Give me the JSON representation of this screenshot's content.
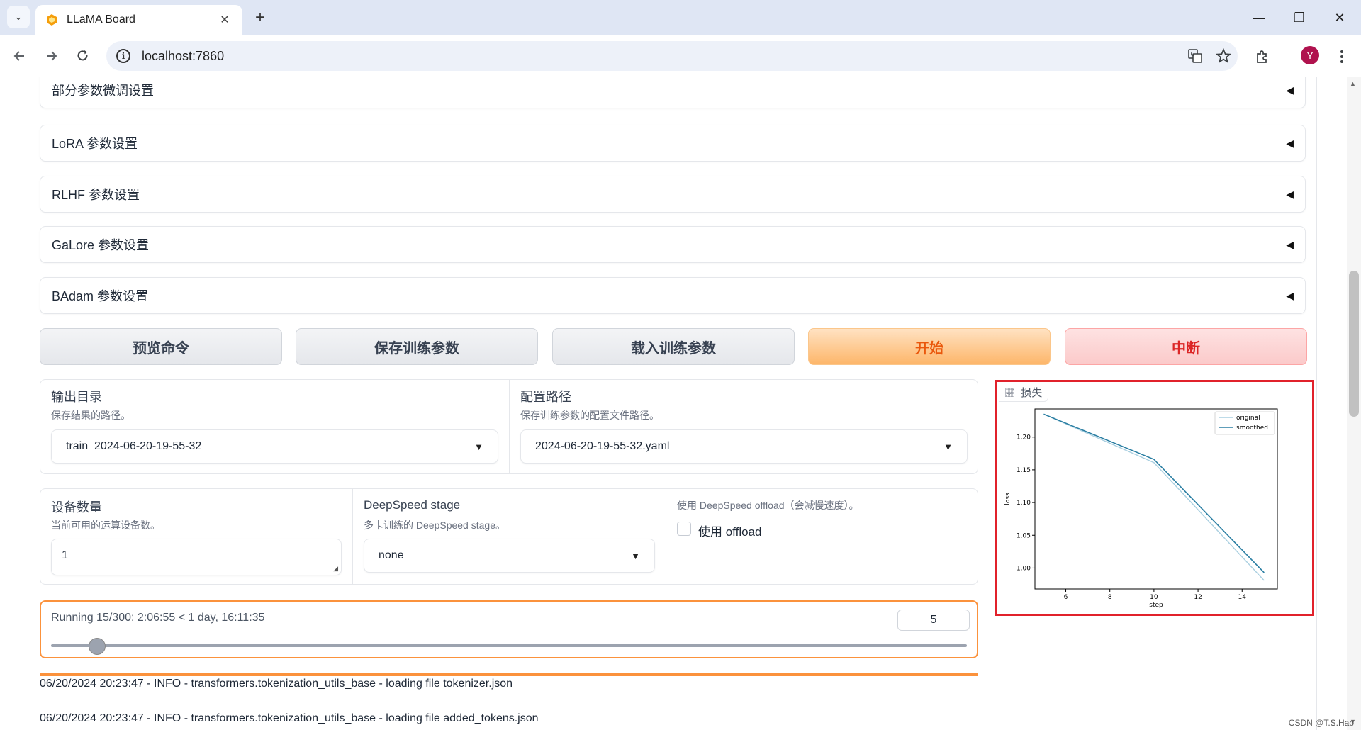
{
  "browser": {
    "tab_title": "LLaMA Board",
    "tab_close": "✕",
    "new_tab": "+",
    "tab_menu": "⌄",
    "url": "localhost:7860",
    "avatar_letter": "Y",
    "info_glyph": "i",
    "minimize": "—",
    "restore": "❐",
    "close": "✕"
  },
  "accordions": [
    {
      "label": "部分参数微调设置"
    },
    {
      "label": "LoRA 参数设置"
    },
    {
      "label": "RLHF 参数设置"
    },
    {
      "label": "GaLore 参数设置"
    },
    {
      "label": "BAdam 参数设置"
    }
  ],
  "accordion_caret": "◀",
  "actions": {
    "preview": "预览命令",
    "save": "保存训练参数",
    "load": "载入训练参数",
    "start": "开始",
    "stop": "中断"
  },
  "output_dir": {
    "title": "输出目录",
    "info": "保存结果的路径。",
    "value": "train_2024-06-20-19-55-32"
  },
  "config_path": {
    "title": "配置路径",
    "info": "保存训练参数的配置文件路径。",
    "value": "2024-06-20-19-55-32.yaml"
  },
  "device_count": {
    "title": "设备数量",
    "info": "当前可用的运算设备数。",
    "value": "1"
  },
  "deepspeed_stage": {
    "title": "DeepSpeed stage",
    "info": "多卡训练的 DeepSpeed stage。",
    "value": "none"
  },
  "deepspeed_offload": {
    "info": "使用 DeepSpeed offload（会减慢速度）。",
    "label": "使用 offload",
    "checked": false
  },
  "dropdown_caret": "▼",
  "progress": {
    "text": "Running 15/300: 2:06:55 < 1 day, 16:11:35",
    "number": "5",
    "slider_fraction": 0.05
  },
  "logs": [
    "06/20/2024 20:23:47 - INFO - transformers.tokenization_utils_base - loading file tokenizer.json",
    "06/20/2024 20:23:47 - INFO - transformers.tokenization_utils_base - loading file added_tokens.json"
  ],
  "plot_label": "损失",
  "chart_data": {
    "type": "line",
    "title": "",
    "xlabel": "step",
    "ylabel": "loss",
    "xlim": [
      4.6,
      15.6
    ],
    "ylim": [
      0.968,
      1.243
    ],
    "xticks": [
      6,
      8,
      10,
      12,
      14
    ],
    "yticks": [
      1.0,
      1.05,
      1.1,
      1.15,
      1.2
    ],
    "xtick_labels": [
      "6",
      "8",
      "10",
      "12",
      "14"
    ],
    "ytick_labels": [
      "1.00",
      "1.05",
      "1.10",
      "1.15",
      "1.20"
    ],
    "legend_position": "top-right",
    "grid": false,
    "series": [
      {
        "name": "original",
        "color": "#a9cfe0",
        "x": [
          5,
          10,
          15
        ],
        "y": [
          1.235,
          1.161,
          0.981
        ]
      },
      {
        "name": "smoothed",
        "color": "#2c7fa3",
        "x": [
          5,
          10,
          15
        ],
        "y": [
          1.235,
          1.166,
          0.993
        ]
      }
    ]
  },
  "watermark": "CSDN @T.S.Hao"
}
